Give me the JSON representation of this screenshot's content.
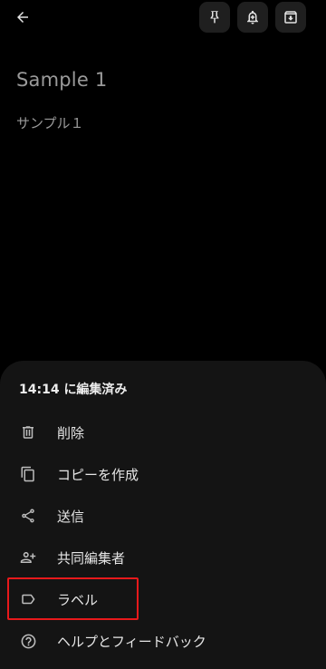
{
  "note": {
    "title": "Sample 1",
    "body": "サンプル１"
  },
  "toolbar": {
    "icons": [
      "back-arrow-icon",
      "pin-icon",
      "reminder-icon",
      "archive-icon"
    ]
  },
  "sheet": {
    "edited_label": "14:14 に編集済み",
    "items": [
      {
        "label": "削除",
        "icon": "trash-icon"
      },
      {
        "label": "コピーを作成",
        "icon": "copy-icon"
      },
      {
        "label": "送信",
        "icon": "share-icon"
      },
      {
        "label": "共同編集者",
        "icon": "add-person-icon"
      },
      {
        "label": "ラベル",
        "icon": "label-icon"
      },
      {
        "label": "ヘルプとフィードバック",
        "icon": "help-icon"
      }
    ]
  },
  "colors": {
    "background": "#000000",
    "sheet": "#141414",
    "highlight": "#e8191b"
  }
}
